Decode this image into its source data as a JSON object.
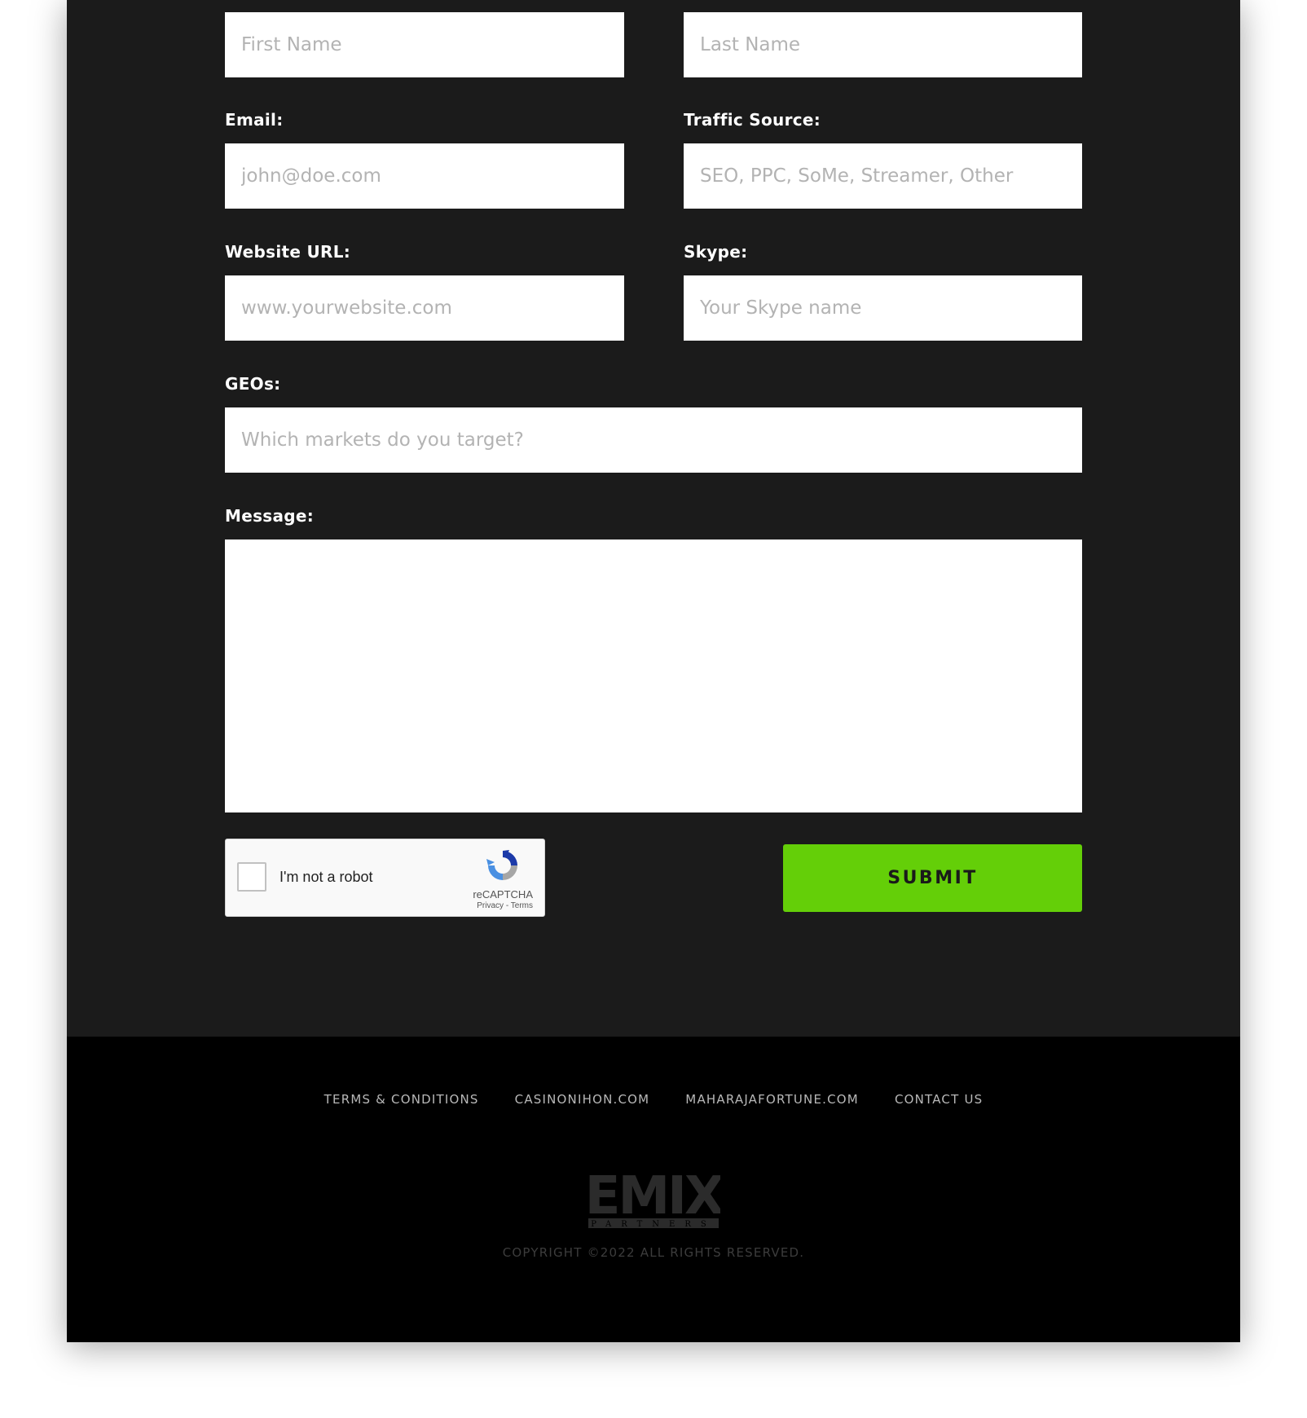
{
  "form": {
    "first_name": {
      "placeholder": "First Name"
    },
    "last_name": {
      "placeholder": "Last Name"
    },
    "email": {
      "label": "Email:",
      "placeholder": "john@doe.com"
    },
    "traffic_source": {
      "label": "Traffic Source:",
      "placeholder": "SEO, PPC, SoMe, Streamer, Other"
    },
    "website_url": {
      "label": "Website URL:",
      "placeholder": "www.yourwebsite.com"
    },
    "skype": {
      "label": "Skype:",
      "placeholder": "Your Skype name"
    },
    "geos": {
      "label": "GEOs:",
      "placeholder": "Which markets do you target?"
    },
    "message": {
      "label": "Message:",
      "value": ""
    },
    "submit_label": "SUBMIT"
  },
  "recaptcha": {
    "label": "I'm not a robot",
    "brand": "reCAPTCHA",
    "privacy": "Privacy",
    "separator": "-",
    "terms": "Terms",
    "checked": false
  },
  "footer": {
    "links": [
      "TERMS & CONDITIONS",
      "CASINONIHON.COM",
      "MAHARAJAFORTUNE.COM",
      "CONTACT US"
    ],
    "logo": {
      "word": "EMIX",
      "sub": "PARTNERS"
    },
    "copyright": "COPYRIGHT ©2022 ALL RIGHTS RESERVED."
  },
  "colors": {
    "form_background": "#1b1b1b",
    "footer_background": "#000000",
    "accent": "#64cf08",
    "logo": "#2b2b2b"
  },
  "icons": {
    "recaptcha_logo": "recaptcha-logo-icon"
  }
}
